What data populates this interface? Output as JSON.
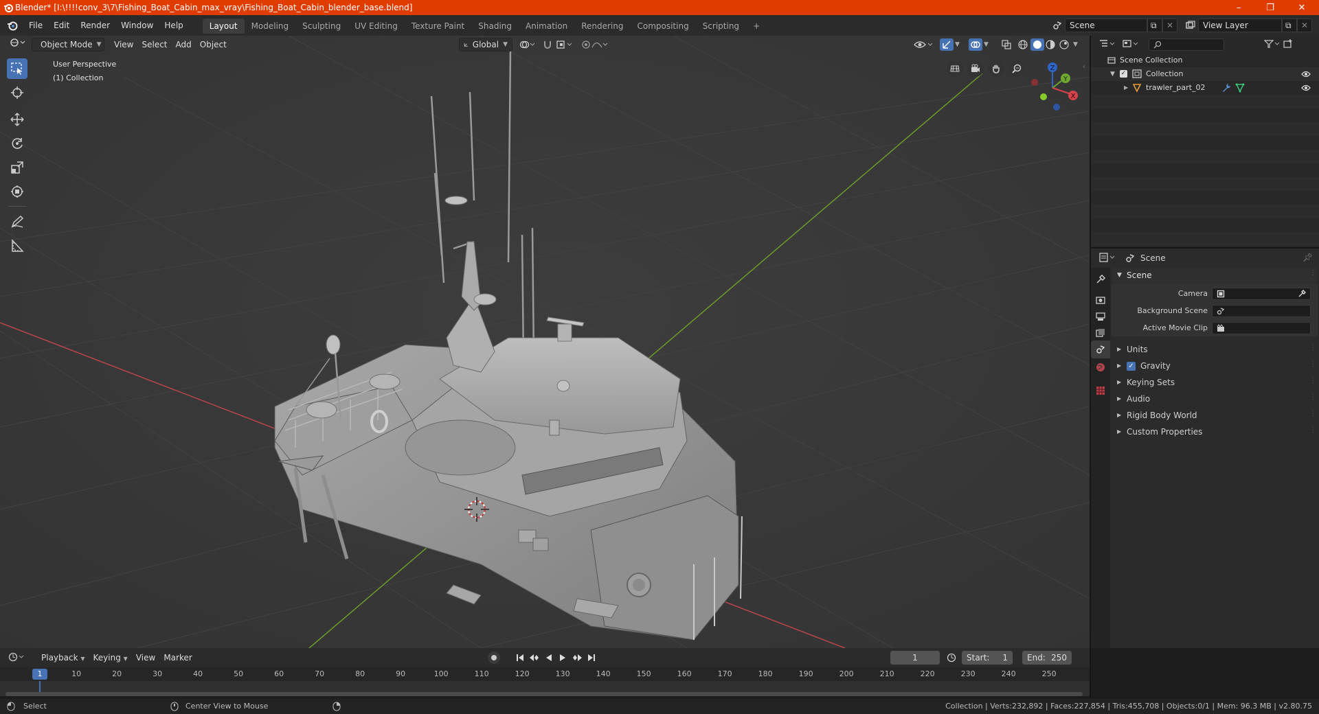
{
  "window": {
    "title": "Blender* [I:\\!!!!conv_3\\7\\Fishing_Boat_Cabin_max_vray\\Fishing_Boat_Cabin_blender_base.blend]",
    "minimize": "–",
    "maximize": "❐",
    "close": "✕"
  },
  "menu": {
    "items": [
      "File",
      "Edit",
      "Render",
      "Window",
      "Help"
    ]
  },
  "workspaces": [
    "Layout",
    "Modeling",
    "Sculpting",
    "UV Editing",
    "Texture Paint",
    "Shading",
    "Animation",
    "Rendering",
    "Compositing",
    "Scripting"
  ],
  "workspace_add": "+",
  "scene_selector": {
    "value": "Scene"
  },
  "view_layer_selector": {
    "value": "View Layer"
  },
  "viewport": {
    "mode": "Object Mode",
    "menus": [
      "View",
      "Select",
      "Add",
      "Object"
    ],
    "orientation": "Global",
    "overlay_text": {
      "line1": "User Perspective",
      "line2": "(1) Collection"
    },
    "gizmo_axes": {
      "z": "Z",
      "y": "Y",
      "x": "X"
    },
    "colors": {
      "bg": "#393939",
      "x_axis": "#b8464b",
      "y_axis": "#6d9a2a",
      "grid": "#434343",
      "active_tool": "#4772b3"
    }
  },
  "outliner": {
    "search_placeholder": "",
    "root": "Scene Collection",
    "collection": "Collection",
    "object": "trawler_part_02"
  },
  "properties": {
    "header_title": "Scene",
    "section_title": "Scene",
    "fields": [
      {
        "label": "Camera",
        "value": ""
      },
      {
        "label": "Background Scene",
        "value": ""
      },
      {
        "label": "Active Movie Clip",
        "value": ""
      }
    ],
    "panels": [
      "Units",
      "Gravity",
      "Keying Sets",
      "Audio",
      "Rigid Body World",
      "Custom Properties"
    ],
    "gravity_checked": true
  },
  "timeline": {
    "menus": [
      "Playback",
      "Keying",
      "View",
      "Marker"
    ],
    "current_frame": "1",
    "start_label": "Start:",
    "start": "1",
    "end_label": "End:",
    "end": "250",
    "ruler": [
      "1",
      "10",
      "20",
      "30",
      "40",
      "50",
      "60",
      "70",
      "80",
      "90",
      "100",
      "110",
      "120",
      "130",
      "140",
      "150",
      "160",
      "170",
      "180",
      "190",
      "200",
      "210",
      "220",
      "230",
      "240",
      "250"
    ]
  },
  "statusbar": {
    "select": "Select",
    "center_view": "Center View to Mouse",
    "stats": "Collection | Verts:232,892 | Faces:227,854 | Tris:455,708 | Objects:0/1 | Mem: 96.3 MB | v2.80.75"
  }
}
